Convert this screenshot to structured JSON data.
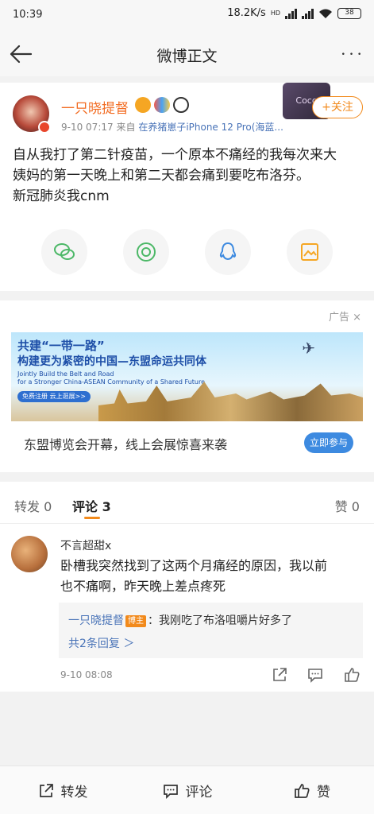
{
  "status_bar": {
    "time": "10:39",
    "speed": "18.2K/s",
    "network": "HD",
    "battery": "38"
  },
  "nav": {
    "title": "微博正文",
    "back_icon": "arrow-left-icon",
    "more_icon": "more-dots-icon",
    "more_glyph": "• • •"
  },
  "post": {
    "author": "一只晓提督",
    "time": "9-10 07:17",
    "from_label": "来自",
    "source": "在养猪崽子iPhone 12 Pro(海蓝...",
    "follow_label": "+关注",
    "deco_text": "Coco",
    "text_line1": "自从我打了第二针疫苗，一个原本不痛经的我每次来大",
    "text_line2": "姨妈的第一天晚上和第二天都会痛到要吃布洛芬。",
    "text_line3": "新冠肺炎我cnm",
    "share_icons": [
      "wechat-icon",
      "moments-icon",
      "qq-icon",
      "save-image-icon"
    ],
    "share_colors": {
      "wechat": "#4cb867",
      "moments": "#4cb867",
      "qq": "#3d8ae0",
      "save": "#f5a623"
    }
  },
  "ad": {
    "label": "广告",
    "close": "×",
    "banner_line1": "共建“一带一路”",
    "banner_line2": "构建更为紧密的中国—东盟命运共同体",
    "banner_en1": "Jointly Build the Belt and Road",
    "banner_en2": "for a Stronger China-ASEAN Community of a Shared Future",
    "banner_pill": "免费注册 云上逛展>>",
    "title": "东盟博览会开幕，线上会展惊喜来袭",
    "cta": "立即参与"
  },
  "comments": {
    "tabs": [
      "转发 0",
      "评论 3",
      "赞 0"
    ],
    "active_tab": 1,
    "item": {
      "author": "不言超甜x",
      "text_line1": "卧槽我突然找到了这两个月痛经的原因，我以前",
      "text_line2": "也不痛啊，昨天晚上差点疼死",
      "reply_author": "一只晓提督",
      "reply_badge": "博主",
      "reply_text": "：我刚吃了布洛咀嚼片好多了",
      "reply_more": "共2条回复 ＞",
      "time": "9-10 08:08"
    }
  },
  "bottom_bar": {
    "repost": "转发",
    "comment": "评论",
    "like": "赞"
  },
  "colors": {
    "accent": "#f28a1c",
    "link": "#4a74b8",
    "username": "#f26c22"
  }
}
